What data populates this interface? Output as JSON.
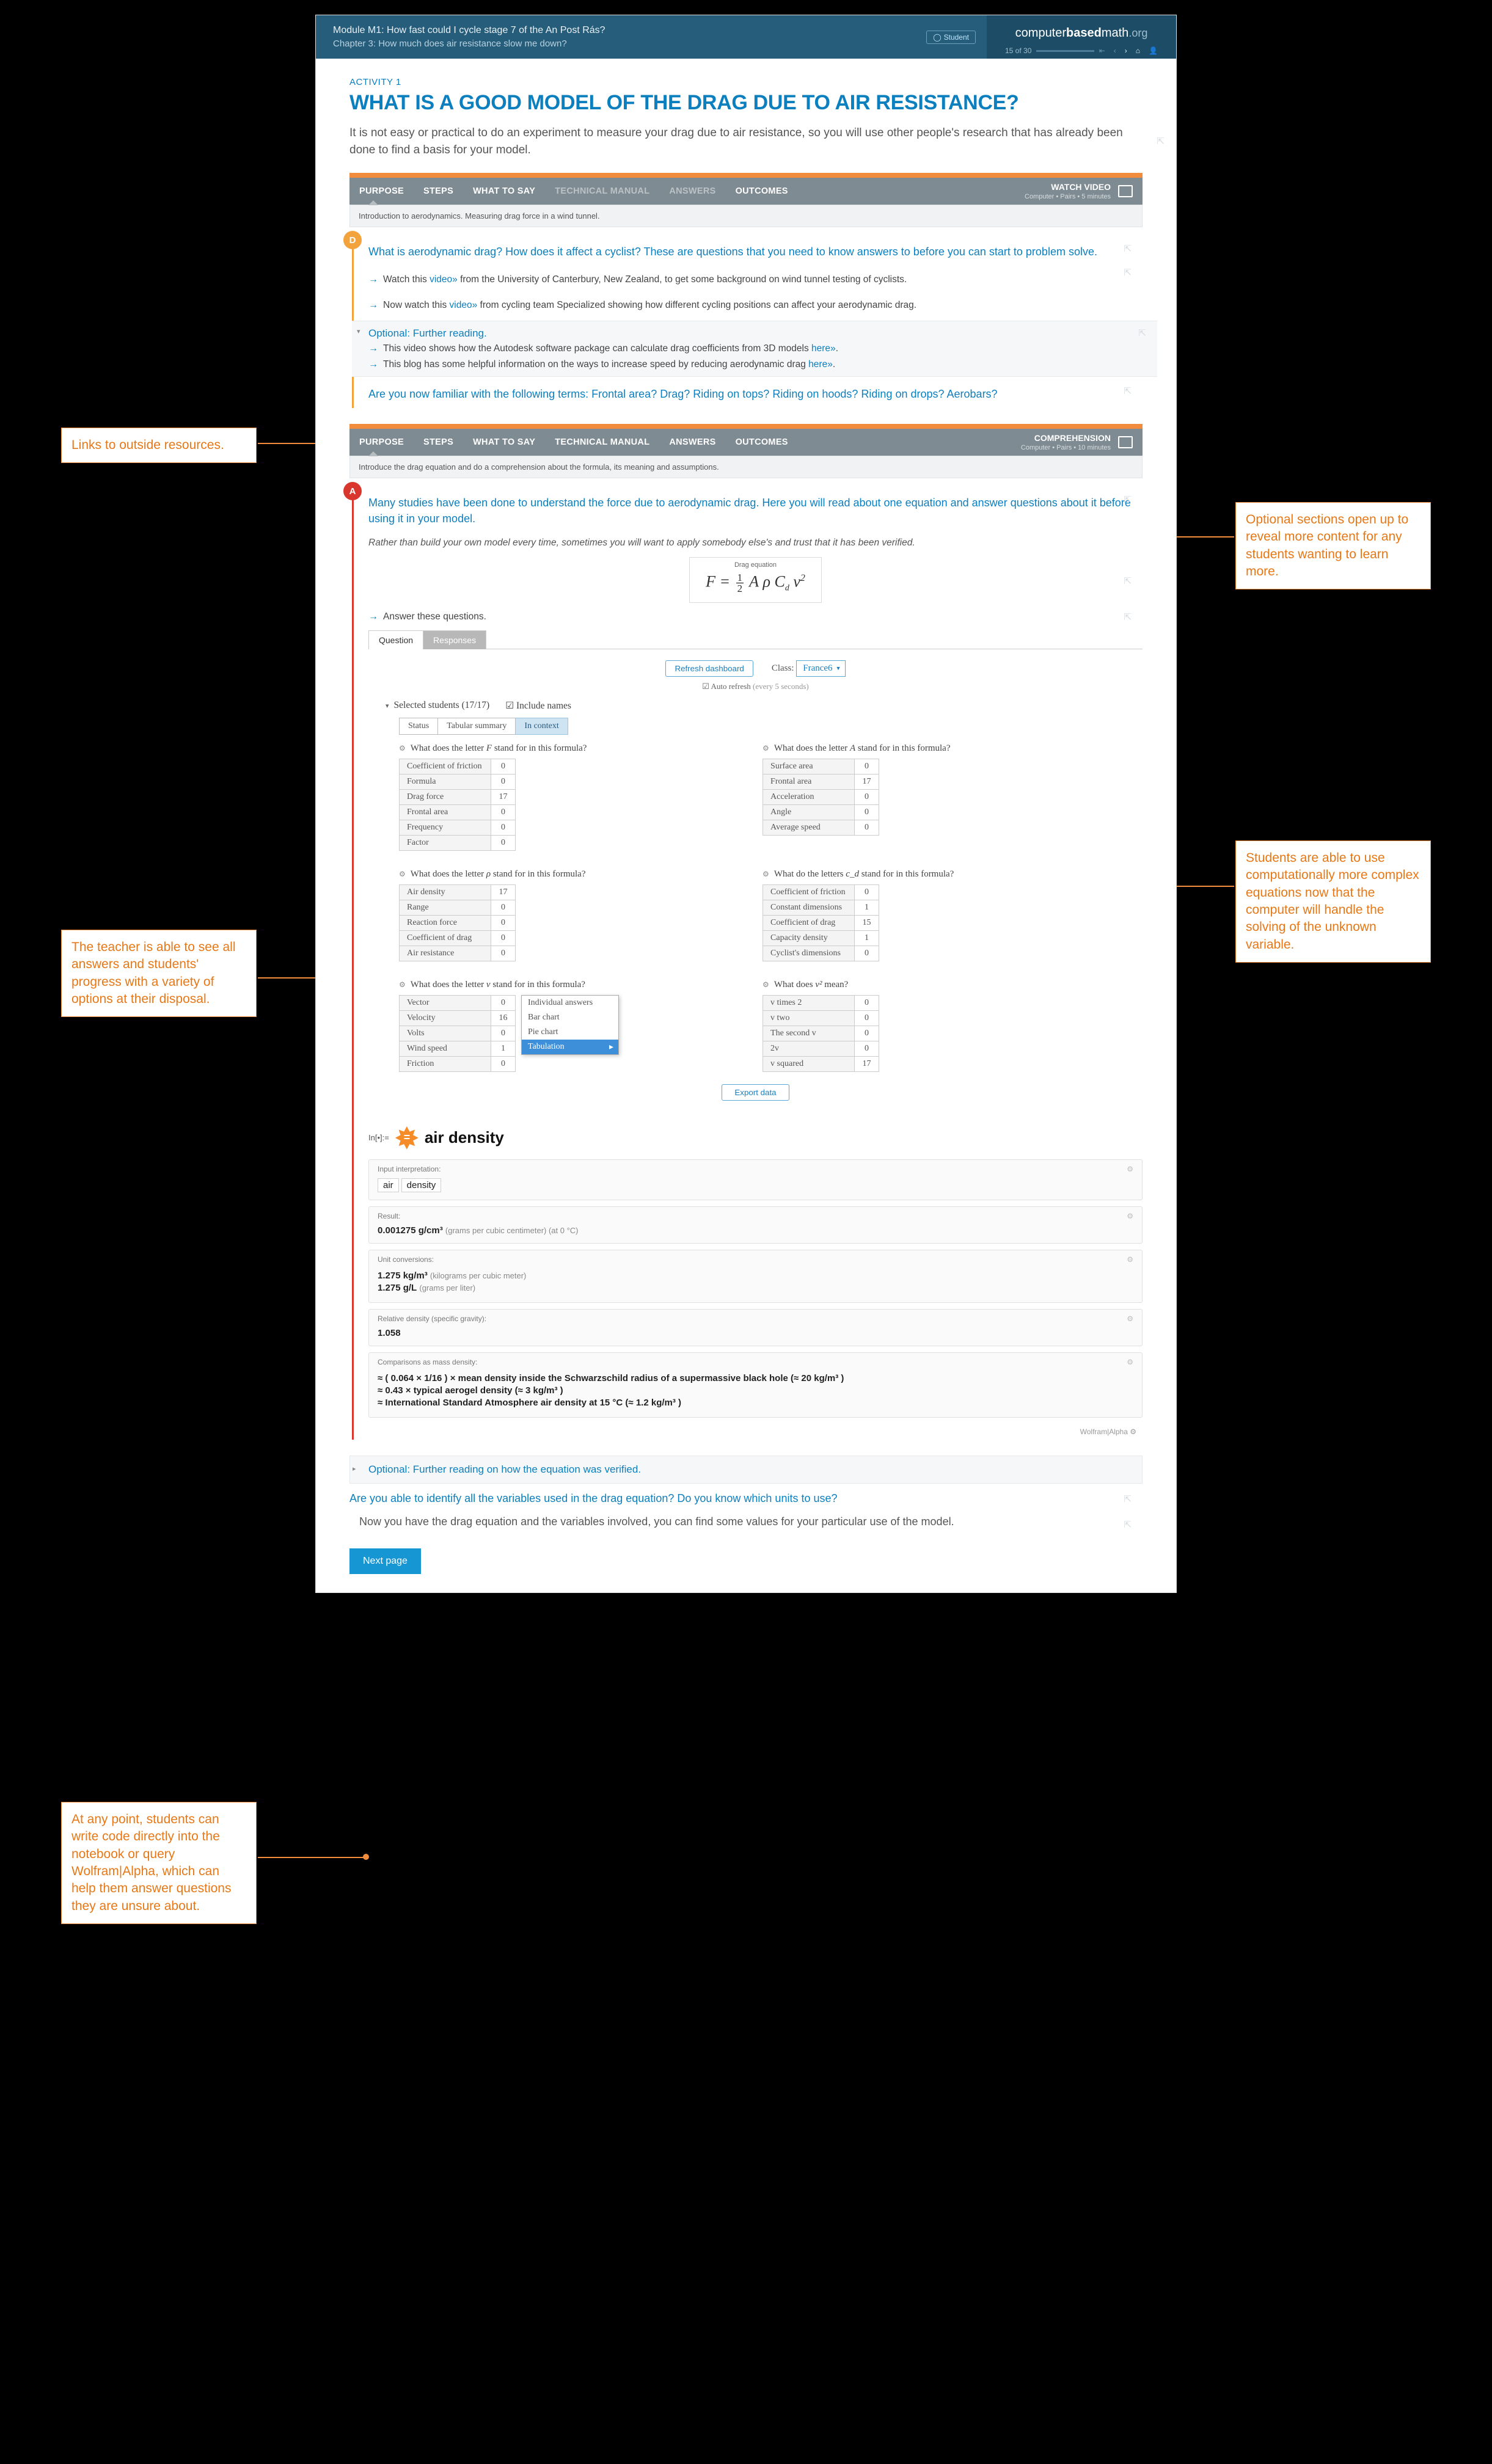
{
  "header": {
    "module": "Module M1: How fast could I cycle stage 7 of the An Post Rás?",
    "chapter": "Chapter 3: How much does air resistance slow me down?",
    "student_btn": "Student",
    "brand_pre": "computer",
    "brand_mid": "based",
    "brand_post": "math",
    "brand_org": ".org",
    "progress": "15 of 30",
    "nav": {
      "first": "⇤",
      "prev": "‹",
      "next": "›",
      "home": "⌂",
      "user": "👤"
    }
  },
  "body": {
    "activity_label": "ACTIVITY 1",
    "title": "WHAT IS A GOOD MODEL OF THE DRAG DUE TO AIR RESISTANCE?",
    "intro": "It is not easy or practical to do an experiment to measure your drag due to air resistance, so you will use other people's research that has already been done to find a basis for your model."
  },
  "bar1": {
    "tabs": [
      "PURPOSE",
      "STEPS",
      "WHAT TO SAY",
      "TECHNICAL MANUAL",
      "ANSWERS",
      "OUTCOMES"
    ],
    "dim_indexes": [
      3,
      4
    ],
    "meta_title": "WATCH VIDEO",
    "meta_sub": "Computer • Pairs • 5 minutes",
    "caption": "Introduction to aerodynamics. Measuring drag force in a wind tunnel."
  },
  "tl1": {
    "badge": "D",
    "q": "What is aerodynamic drag? How does it affect a cyclist? These are questions that you need to know answers to before you can start to problem solve.",
    "s1_pre": "Watch this ",
    "s1_link": "video»",
    "s1_post": " from the University of Canterbury, New Zealand, to get some background on wind tunnel testing of cyclists.",
    "s2_pre": "Now watch this ",
    "s2_link": "video»",
    "s2_post": " from cycling team Specialized showing how different cycling positions can affect your aerodynamic drag.",
    "opt_title": "Optional: Further reading.",
    "opt_s1_pre": "This video shows how the Autodesk software package can calculate drag coefficients from 3D models ",
    "opt_s1_link": "here»",
    "opt_s1_post": ".",
    "opt_s2_pre": "This blog has some helpful information on the ways to increase speed by reducing aerodynamic drag ",
    "opt_s2_link": "here»",
    "opt_s2_post": ".",
    "q2": "Are you now familiar with the following terms: Frontal area? Drag? Riding on tops? Riding on hoods? Riding on drops? Aerobars?"
  },
  "bar2": {
    "tabs": [
      "PURPOSE",
      "STEPS",
      "WHAT TO SAY",
      "TECHNICAL MANUAL",
      "ANSWERS",
      "OUTCOMES"
    ],
    "meta_title": "COMPREHENSION",
    "meta_sub": "Computer • Pairs • 10 minutes",
    "caption": "Introduce the drag equation and do a comprehension about the formula, its meaning and assumptions."
  },
  "tl2": {
    "badge": "A",
    "q": "Many studies have been done to understand the force due to aerodynamic drag. Here you will read about one equation and answer questions about it before using it in your model.",
    "note": "Rather than build your own model every time, sometimes you will want to apply somebody else's and trust that it has been verified.",
    "formula_label": "Drag equation",
    "formula_parts": {
      "F": "F",
      "eq": "=",
      "half_n": "1",
      "half_d": "2",
      "A": "A",
      "rho": "ρ",
      "C": "C",
      "d": "d",
      "v": "v",
      "sq": "2"
    },
    "answer_prompt": "Answer these questions."
  },
  "dash": {
    "tab_q": "Question",
    "tab_r": "Responses",
    "refresh": "Refresh dashboard",
    "class_lbl": "Class:",
    "class_val": "France6",
    "auto": "☑ Auto refresh",
    "auto_sub": "(every 5 seconds)",
    "selected": "Selected students (17/17)",
    "include": "☑ Include names",
    "vt1": "Status",
    "vt2": "Tabular summary",
    "vt3": "In context",
    "questions": [
      {
        "title_pre": "What does the letter ",
        "title_var": "F",
        "title_post": " stand for in this formula?",
        "rows": [
          [
            "Coefficient of friction",
            "0"
          ],
          [
            "Formula",
            "0"
          ],
          [
            "Drag force",
            "17"
          ],
          [
            "Frontal area",
            "0"
          ],
          [
            "Frequency",
            "0"
          ],
          [
            "Factor",
            "0"
          ]
        ]
      },
      {
        "title_pre": "What does the letter ",
        "title_var": "A",
        "title_post": " stand for in this formula?",
        "rows": [
          [
            "Surface area",
            "0"
          ],
          [
            "Frontal area",
            "17"
          ],
          [
            "Acceleration",
            "0"
          ],
          [
            "Angle",
            "0"
          ],
          [
            "Average speed",
            "0"
          ]
        ]
      },
      {
        "title_pre": "What does the letter ",
        "title_var": "ρ",
        "title_post": " stand for in this formula?",
        "rows": [
          [
            "Air density",
            "17"
          ],
          [
            "Range",
            "0"
          ],
          [
            "Reaction force",
            "0"
          ],
          [
            "Coefficient of drag",
            "0"
          ],
          [
            "Air resistance",
            "0"
          ]
        ]
      },
      {
        "title_pre": "What do the letters ",
        "title_var": "c_d",
        "title_post": " stand for in this formula?",
        "rows": [
          [
            "Coefficient of friction",
            "0"
          ],
          [
            "Constant dimensions",
            "1"
          ],
          [
            "Coefficient of drag",
            "15"
          ],
          [
            "Capacity density",
            "1"
          ],
          [
            "Cyclist's dimensions",
            "0"
          ]
        ]
      },
      {
        "title_pre": "What does the letter ",
        "title_var": "v",
        "title_post": " stand for in this formula?",
        "rows": [
          [
            "Vector",
            "0"
          ],
          [
            "Velocity",
            "16"
          ],
          [
            "Volts",
            "0"
          ],
          [
            "Wind speed",
            "1"
          ],
          [
            "Friction",
            "0"
          ]
        ]
      },
      {
        "title_pre": "What does ",
        "title_var": "v²",
        "title_post": " mean?",
        "rows": [
          [
            "v times 2",
            "0"
          ],
          [
            "v two",
            "0"
          ],
          [
            "The second v",
            "0"
          ],
          [
            "2v",
            "0"
          ],
          [
            "v squared",
            "17"
          ]
        ]
      }
    ],
    "dropdown": [
      "Individual answers",
      "Bar chart",
      "Pie chart",
      "Tabulation"
    ],
    "export": "Export data"
  },
  "wa": {
    "in_lbl": "In[•]:=",
    "star": "=",
    "query": "air density",
    "cards": [
      {
        "label": "Input interpretation:",
        "chips": [
          "air",
          "density"
        ]
      },
      {
        "label": "Result:",
        "val": "0.001275 g/cm³",
        "unit": "(grams per cubic centimeter)  (at 0 °C)"
      },
      {
        "label": "Unit conversions:",
        "rows": [
          {
            "v": "1.275 kg/m³",
            "u": "(kilograms per cubic meter)"
          },
          {
            "v": "1.275 g/L",
            "u": "(grams per liter)"
          }
        ]
      },
      {
        "label": "Relative density (specific gravity):",
        "val": "1.058"
      },
      {
        "label": "Comparisons as mass density:",
        "rows": [
          {
            "v": "≈ ( 0.064 × 1/16 ) × mean density inside the Schwarzschild radius of a supermassive black hole (≈ 20 kg/m³ )"
          },
          {
            "v": "≈ 0.43 × typical aerogel density (≈ 3 kg/m³ )"
          },
          {
            "v": "≈ International Standard Atmosphere air density at 15 °C (≈ 1.2 kg/m³ )"
          }
        ]
      }
    ],
    "footer": "Wolfram|Alpha  ⚙"
  },
  "closing": {
    "opt": "Optional: Further reading on how the equation was verified.",
    "q": "Are you able to identify all the variables used in the drag equation? Do you know which units to use?",
    "p": "Now you have the drag equation and the variables involved, you can find some values for your particular use of the model.",
    "next": "Next page"
  },
  "callouts": {
    "c1": "Links to outside resources.",
    "c2": "Optional sections open up to reveal more content for any students wanting to learn more.",
    "c3": "Students are able to use computationally more complex equations now that the computer will handle the solving of the unknown variable.",
    "c4": "The teacher is able to see all answers and students' progress with a variety of options at their disposal.",
    "c5": "At any point, students can write code directly into the notebook or query Wolfram|Alpha, which can help them answer questions they are unsure about."
  },
  "chart_data": {
    "type": "table",
    "title": "Student response tabulation per question",
    "questions": [
      {
        "question": "What does the letter F stand for in this formula?",
        "responses": {
          "Coefficient of friction": 0,
          "Formula": 0,
          "Drag force": 17,
          "Frontal area": 0,
          "Frequency": 0,
          "Factor": 0
        }
      },
      {
        "question": "What does the letter A stand for in this formula?",
        "responses": {
          "Surface area": 0,
          "Frontal area": 17,
          "Acceleration": 0,
          "Angle": 0,
          "Average speed": 0
        }
      },
      {
        "question": "What does the letter ρ stand for in this formula?",
        "responses": {
          "Air density": 17,
          "Range": 0,
          "Reaction force": 0,
          "Coefficient of drag": 0,
          "Air resistance": 0
        }
      },
      {
        "question": "What do the letters c_d stand for in this formula?",
        "responses": {
          "Coefficient of friction": 0,
          "Constant dimensions": 1,
          "Coefficient of drag": 15,
          "Capacity density": 1,
          "Cyclist's dimensions": 0
        }
      },
      {
        "question": "What does the letter v stand for in this formula?",
        "responses": {
          "Vector": 0,
          "Velocity": 16,
          "Volts": 0,
          "Wind speed": 1,
          "Friction": 0
        }
      },
      {
        "question": "What does v² mean?",
        "responses": {
          "v times 2": 0,
          "v two": 0,
          "The second v": 0,
          "2v": 0,
          "v squared": 17
        }
      }
    ],
    "total_students": 17
  }
}
